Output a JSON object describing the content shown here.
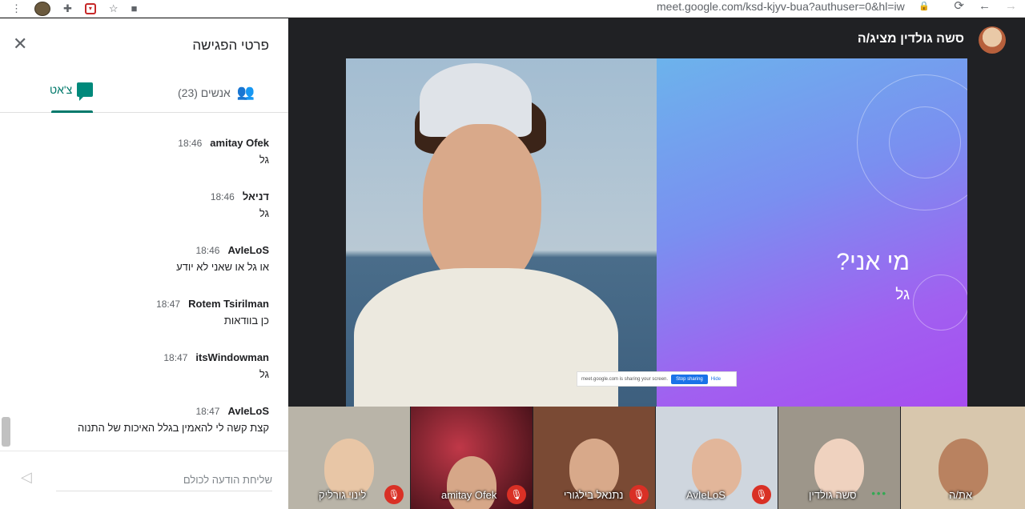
{
  "browser": {
    "url": "meet.google.com/ksd-kjyv-bua?authuser=0&hl=iw",
    "icons": [
      "more-vert-icon",
      "profile-avatar",
      "puzzle-extension-icon",
      "shield-extension-icon",
      "star-icon",
      "media-icon",
      "lock-icon",
      "reload-icon",
      "back-icon",
      "forward-icon"
    ]
  },
  "panel": {
    "title": "פרטי הפגישה",
    "tabs": {
      "people_label": "אנשים (23)",
      "chat_label": "צ'אט"
    },
    "messages": [
      {
        "sender": "amitay Ofek",
        "time": "18:46",
        "text": "גל"
      },
      {
        "sender": "דניאל",
        "time": "18:46",
        "text": "גל"
      },
      {
        "sender": "AvIeLoS",
        "time": "18:46",
        "text": "או גל או שאני לא יודע"
      },
      {
        "sender": "Rotem Tsirilman",
        "time": "18:47",
        "text": "כן בוודאות"
      },
      {
        "sender": "itsWindowman",
        "time": "18:47",
        "text": "גל"
      },
      {
        "sender": "AvIeLoS",
        "time": "18:47",
        "text": "קצת קשה לי להאמין בגלל האיכות של התנוה"
      }
    ],
    "composer_placeholder": "שליחת הודעה לכולם"
  },
  "stage": {
    "presenter_label": "סשה גולדין מציג/ה",
    "slide": {
      "title": "מי אני?",
      "subtitle": "גל"
    },
    "share_notice": {
      "text": "meet.google.com is sharing your screen.",
      "stop_label": "Stop sharing",
      "hide_label": "Hide"
    },
    "participants": [
      {
        "name": "לינוי גורליק",
        "muted": true,
        "bg": "#b9b4a8",
        "skin": "#e8c6a6"
      },
      {
        "name": "amitay Ofek",
        "muted": true,
        "bg": "#5a1a22",
        "skin": "#d6a788"
      },
      {
        "name": "נתנאל בילגורי",
        "muted": true,
        "bg": "#7a4a34",
        "skin": "#d8a98a"
      },
      {
        "name": "AvIeLoS",
        "muted": true,
        "bg": "#cfd6de",
        "skin": "#e2b69a"
      },
      {
        "name": "סשה גולדין",
        "muted": false,
        "bg": "#9d968a",
        "skin": "#efd2bf"
      },
      {
        "name": "את/ה",
        "muted": false,
        "bg": "#d8c7ad",
        "skin": "#b98260"
      }
    ]
  },
  "colors": {
    "accent": "#00796b",
    "mic_red": "#d93025",
    "speaking_green": "#34a853"
  }
}
